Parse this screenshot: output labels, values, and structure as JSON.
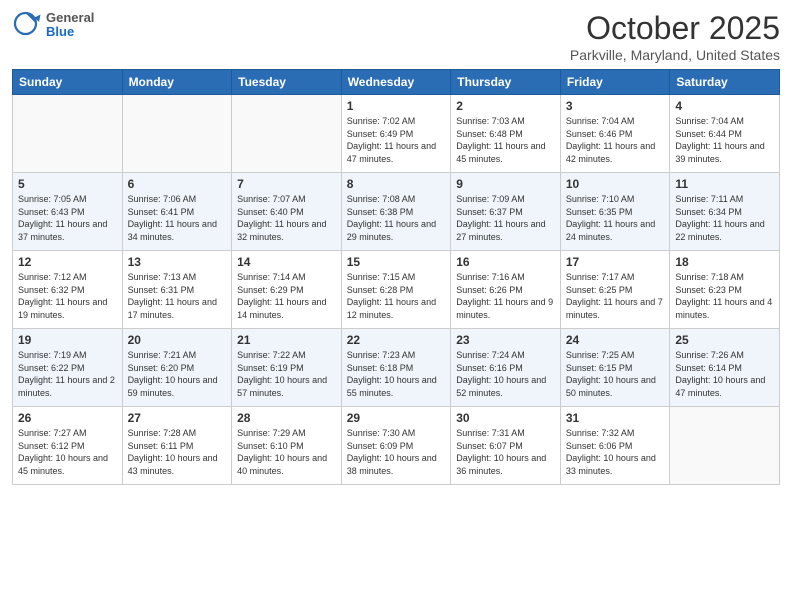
{
  "header": {
    "logo_general": "General",
    "logo_blue": "Blue",
    "month": "October 2025",
    "location": "Parkville, Maryland, United States"
  },
  "days_of_week": [
    "Sunday",
    "Monday",
    "Tuesday",
    "Wednesday",
    "Thursday",
    "Friday",
    "Saturday"
  ],
  "weeks": [
    [
      {
        "day": "",
        "info": ""
      },
      {
        "day": "",
        "info": ""
      },
      {
        "day": "",
        "info": ""
      },
      {
        "day": "1",
        "info": "Sunrise: 7:02 AM\nSunset: 6:49 PM\nDaylight: 11 hours and 47 minutes."
      },
      {
        "day": "2",
        "info": "Sunrise: 7:03 AM\nSunset: 6:48 PM\nDaylight: 11 hours and 45 minutes."
      },
      {
        "day": "3",
        "info": "Sunrise: 7:04 AM\nSunset: 6:46 PM\nDaylight: 11 hours and 42 minutes."
      },
      {
        "day": "4",
        "info": "Sunrise: 7:04 AM\nSunset: 6:44 PM\nDaylight: 11 hours and 39 minutes."
      }
    ],
    [
      {
        "day": "5",
        "info": "Sunrise: 7:05 AM\nSunset: 6:43 PM\nDaylight: 11 hours and 37 minutes."
      },
      {
        "day": "6",
        "info": "Sunrise: 7:06 AM\nSunset: 6:41 PM\nDaylight: 11 hours and 34 minutes."
      },
      {
        "day": "7",
        "info": "Sunrise: 7:07 AM\nSunset: 6:40 PM\nDaylight: 11 hours and 32 minutes."
      },
      {
        "day": "8",
        "info": "Sunrise: 7:08 AM\nSunset: 6:38 PM\nDaylight: 11 hours and 29 minutes."
      },
      {
        "day": "9",
        "info": "Sunrise: 7:09 AM\nSunset: 6:37 PM\nDaylight: 11 hours and 27 minutes."
      },
      {
        "day": "10",
        "info": "Sunrise: 7:10 AM\nSunset: 6:35 PM\nDaylight: 11 hours and 24 minutes."
      },
      {
        "day": "11",
        "info": "Sunrise: 7:11 AM\nSunset: 6:34 PM\nDaylight: 11 hours and 22 minutes."
      }
    ],
    [
      {
        "day": "12",
        "info": "Sunrise: 7:12 AM\nSunset: 6:32 PM\nDaylight: 11 hours and 19 minutes."
      },
      {
        "day": "13",
        "info": "Sunrise: 7:13 AM\nSunset: 6:31 PM\nDaylight: 11 hours and 17 minutes."
      },
      {
        "day": "14",
        "info": "Sunrise: 7:14 AM\nSunset: 6:29 PM\nDaylight: 11 hours and 14 minutes."
      },
      {
        "day": "15",
        "info": "Sunrise: 7:15 AM\nSunset: 6:28 PM\nDaylight: 11 hours and 12 minutes."
      },
      {
        "day": "16",
        "info": "Sunrise: 7:16 AM\nSunset: 6:26 PM\nDaylight: 11 hours and 9 minutes."
      },
      {
        "day": "17",
        "info": "Sunrise: 7:17 AM\nSunset: 6:25 PM\nDaylight: 11 hours and 7 minutes."
      },
      {
        "day": "18",
        "info": "Sunrise: 7:18 AM\nSunset: 6:23 PM\nDaylight: 11 hours and 4 minutes."
      }
    ],
    [
      {
        "day": "19",
        "info": "Sunrise: 7:19 AM\nSunset: 6:22 PM\nDaylight: 11 hours and 2 minutes."
      },
      {
        "day": "20",
        "info": "Sunrise: 7:21 AM\nSunset: 6:20 PM\nDaylight: 10 hours and 59 minutes."
      },
      {
        "day": "21",
        "info": "Sunrise: 7:22 AM\nSunset: 6:19 PM\nDaylight: 10 hours and 57 minutes."
      },
      {
        "day": "22",
        "info": "Sunrise: 7:23 AM\nSunset: 6:18 PM\nDaylight: 10 hours and 55 minutes."
      },
      {
        "day": "23",
        "info": "Sunrise: 7:24 AM\nSunset: 6:16 PM\nDaylight: 10 hours and 52 minutes."
      },
      {
        "day": "24",
        "info": "Sunrise: 7:25 AM\nSunset: 6:15 PM\nDaylight: 10 hours and 50 minutes."
      },
      {
        "day": "25",
        "info": "Sunrise: 7:26 AM\nSunset: 6:14 PM\nDaylight: 10 hours and 47 minutes."
      }
    ],
    [
      {
        "day": "26",
        "info": "Sunrise: 7:27 AM\nSunset: 6:12 PM\nDaylight: 10 hours and 45 minutes."
      },
      {
        "day": "27",
        "info": "Sunrise: 7:28 AM\nSunset: 6:11 PM\nDaylight: 10 hours and 43 minutes."
      },
      {
        "day": "28",
        "info": "Sunrise: 7:29 AM\nSunset: 6:10 PM\nDaylight: 10 hours and 40 minutes."
      },
      {
        "day": "29",
        "info": "Sunrise: 7:30 AM\nSunset: 6:09 PM\nDaylight: 10 hours and 38 minutes."
      },
      {
        "day": "30",
        "info": "Sunrise: 7:31 AM\nSunset: 6:07 PM\nDaylight: 10 hours and 36 minutes."
      },
      {
        "day": "31",
        "info": "Sunrise: 7:32 AM\nSunset: 6:06 PM\nDaylight: 10 hours and 33 minutes."
      },
      {
        "day": "",
        "info": ""
      }
    ]
  ]
}
